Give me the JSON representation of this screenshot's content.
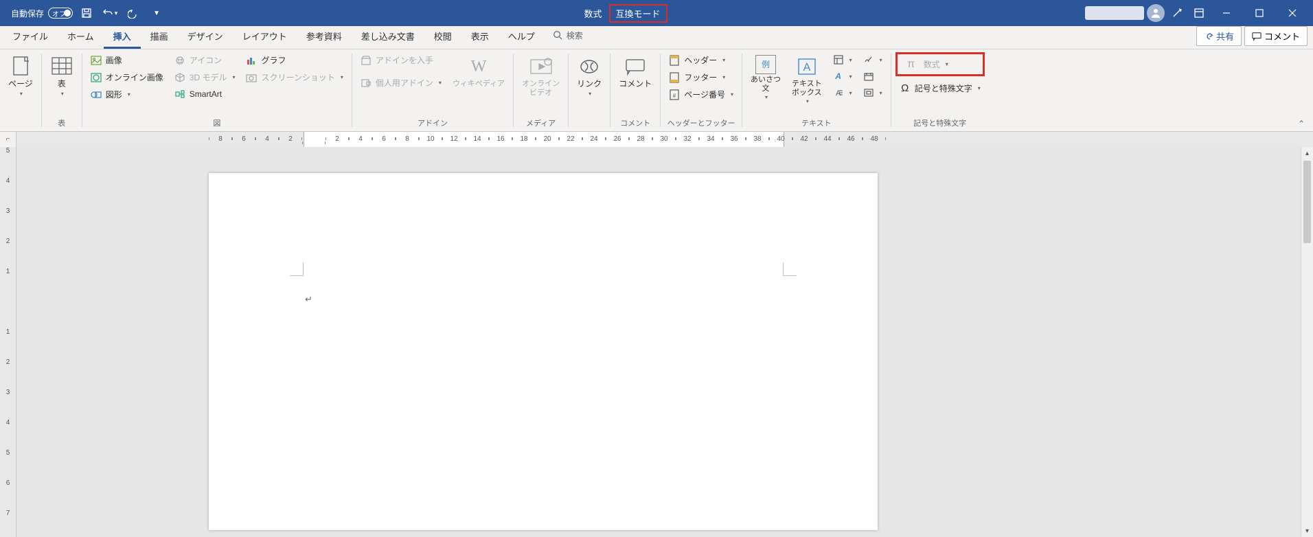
{
  "titlebar": {
    "autosave_label": "自動保存",
    "autosave_state": "オフ",
    "doc_label": "数式",
    "compat_label": "互換モード"
  },
  "tabs": {
    "file": "ファイル",
    "home": "ホーム",
    "insert": "挿入",
    "draw": "描画",
    "design": "デザイン",
    "layout": "レイアウト",
    "references": "参考資料",
    "mailings": "差し込み文書",
    "review": "校閲",
    "view": "表示",
    "help": "ヘルプ",
    "search_placeholder": "検索",
    "share": "共有",
    "comment": "コメント"
  },
  "ribbon": {
    "pages": {
      "page": "ページ",
      "group": "表",
      "table": "表"
    },
    "illustrations": {
      "pictures": "画像",
      "online_pictures": "オンライン画像",
      "shapes": "図形",
      "icons": "アイコン",
      "model3d": "3D モデル",
      "smartart": "SmartArt",
      "chart": "グラフ",
      "screenshot": "スクリーンショット",
      "group": "図"
    },
    "addins": {
      "get": "アドインを入手",
      "my": "個人用アドイン",
      "wikipedia": "ウィキペディア",
      "group": "アドイン"
    },
    "media": {
      "video": "オンライン\nビデオ",
      "group": "メディア"
    },
    "links": {
      "link": "リンク",
      "group": ""
    },
    "comments": {
      "comment": "コメント",
      "group": "コメント"
    },
    "headerfooter": {
      "header": "ヘッダー",
      "footer": "フッター",
      "page_number": "ページ番号",
      "group": "ヘッダーとフッター"
    },
    "text": {
      "greeting": "あいさつ\n文",
      "textbox": "テキスト\nボックス",
      "sample": "例",
      "group": "テキスト"
    },
    "symbols": {
      "equation": "数式",
      "symbol": "記号と特殊文字",
      "group": "記号と特殊文字"
    }
  },
  "ruler": {
    "h": [
      "8",
      "6",
      "4",
      "2",
      "",
      "2",
      "4",
      "6",
      "8",
      "10",
      "12",
      "14",
      "16",
      "18",
      "20",
      "22",
      "24",
      "26",
      "28",
      "30",
      "32",
      "34",
      "36",
      "38",
      "40",
      "42",
      "44",
      "46",
      "48"
    ],
    "v": [
      "5",
      "4",
      "3",
      "2",
      "1",
      "",
      "1",
      "2",
      "3",
      "4",
      "5",
      "6",
      "7"
    ]
  }
}
